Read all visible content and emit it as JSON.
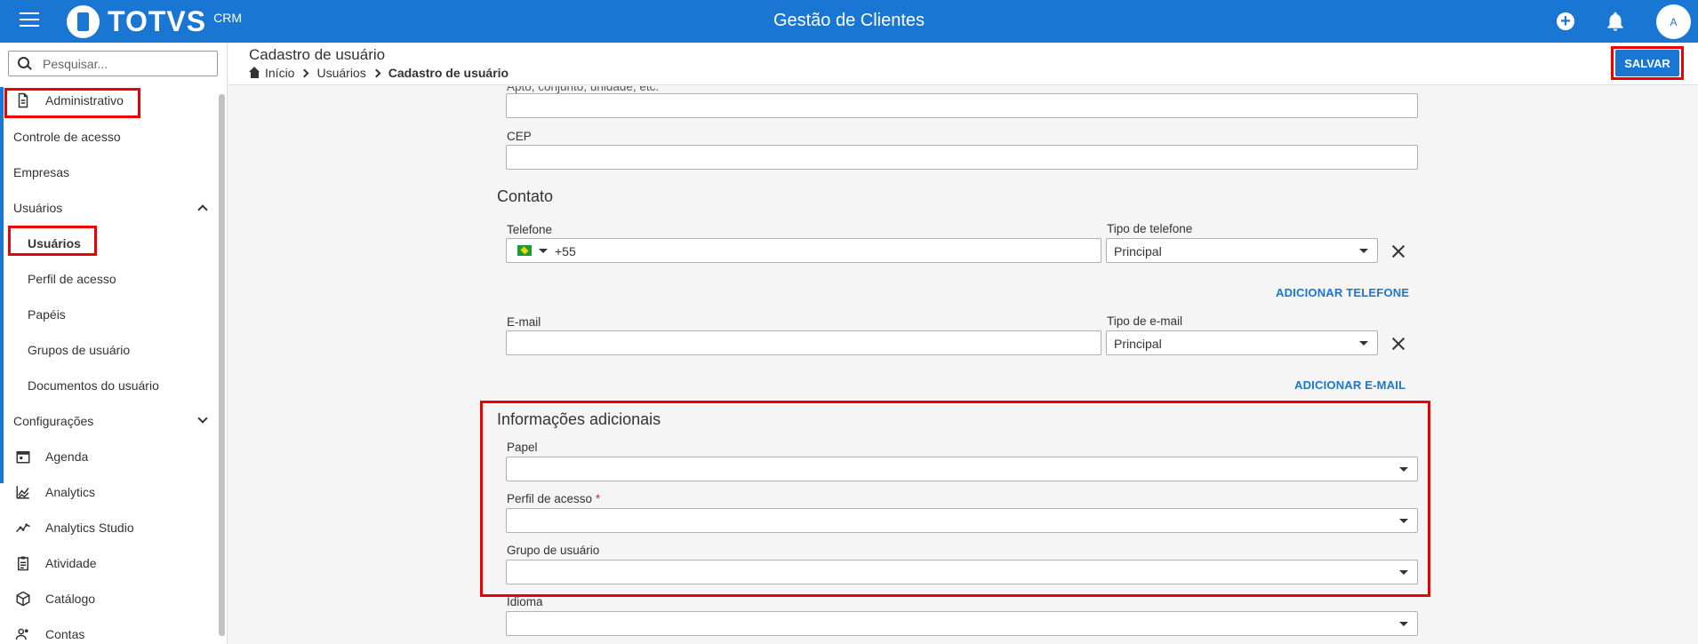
{
  "topbar": {
    "brand": "TOTVS",
    "brand_sub": "CRM",
    "app_title": "Gestão de Clientes",
    "avatar_initial": "A",
    "color": "#1976d2"
  },
  "sidebar": {
    "search_placeholder": "Pesquisar...",
    "items": [
      {
        "label": "Administrativo",
        "icon": "document-icon"
      },
      {
        "label": "Controle de acesso"
      },
      {
        "label": "Empresas"
      },
      {
        "label": "Usuários",
        "expanded": true
      },
      {
        "label": "Usuários",
        "selected": true
      },
      {
        "label": "Perfil de acesso"
      },
      {
        "label": "Papéis"
      },
      {
        "label": "Grupos de usuário"
      },
      {
        "label": "Documentos do usuário"
      },
      {
        "label": "Configurações",
        "expanded": false
      },
      {
        "label": "Agenda",
        "icon": "calendar-icon"
      },
      {
        "label": "Analytics",
        "icon": "area-chart-icon"
      },
      {
        "label": "Analytics Studio",
        "icon": "trend-icon"
      },
      {
        "label": "Atividade",
        "icon": "clipboard-icon"
      },
      {
        "label": "Catálogo",
        "icon": "cube-icon"
      },
      {
        "label": "Contas",
        "icon": "users-icon"
      }
    ]
  },
  "header": {
    "title": "Cadastro de usuário",
    "breadcrumb": [
      "Início",
      "Usuários",
      "Cadastro de usuário"
    ],
    "save_label": "SALVAR"
  },
  "form": {
    "apto_label": "Apto, conjunto, unidade, etc.",
    "cep_label": "CEP",
    "contato_title": "Contato",
    "telefone_label": "Telefone",
    "telefone_code": "+55",
    "tipo_telefone_label": "Tipo de telefone",
    "tipo_telefone_value": "Principal",
    "add_telefone": "ADICIONAR TELEFONE",
    "email_label": "E-mail",
    "tipo_email_label": "Tipo de e-mail",
    "tipo_email_value": "Principal",
    "add_email": "ADICIONAR E-MAIL",
    "info_title": "Informações adicionais",
    "papel_label": "Papel",
    "perfil_label": "Perfil de acesso",
    "perfil_required": "*",
    "grupo_label": "Grupo de usuário",
    "idioma_label": "Idioma"
  },
  "highlight_color": "#ee0000"
}
